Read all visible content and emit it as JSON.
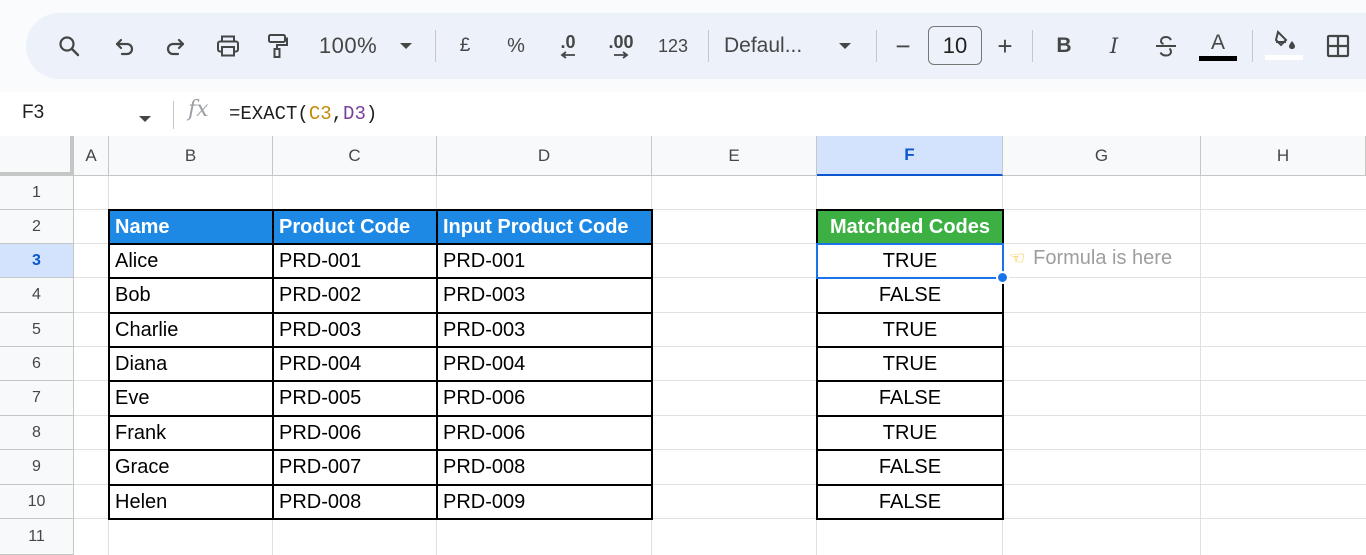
{
  "toolbar": {
    "zoom": "100%",
    "currency_symbol": "£",
    "percent_symbol": "%",
    "decrease_decimal": ".0",
    "increase_decimal": ".00",
    "number_format": "123",
    "font_family": "Defaul...",
    "font_size": "10",
    "minus": "−",
    "plus": "+",
    "bold": "B",
    "italic": "I",
    "text_color_letter": "A",
    "icons": [
      "search-icon",
      "undo-icon",
      "redo-icon",
      "print-icon",
      "paint-format-icon",
      "chevron-down-icon",
      "strikethrough-icon",
      "fill-color-icon",
      "borders-icon"
    ]
  },
  "formula_bar": {
    "name_box": "F3",
    "fx": "fx",
    "formula_prefix": "=EXACT(",
    "ref1": "C3",
    "comma": ",",
    "ref2": "D3",
    "formula_suffix": ")"
  },
  "columns": [
    "A",
    "B",
    "C",
    "D",
    "E",
    "F",
    "G",
    "H"
  ],
  "active_column": "F",
  "rows": [
    "1",
    "2",
    "3",
    "4",
    "5",
    "6",
    "7",
    "8",
    "9",
    "10",
    "11"
  ],
  "active_row": "3",
  "table": {
    "headers": [
      "Name",
      "Product Code",
      "Input Product Code"
    ],
    "rows": [
      [
        "Alice",
        "PRD-001",
        "PRD-001"
      ],
      [
        "Bob",
        "PRD-002",
        "PRD-003"
      ],
      [
        "Charlie",
        "PRD-003",
        "PRD-003"
      ],
      [
        "Diana",
        "PRD-004",
        "PRD-004"
      ],
      [
        "Eve",
        "PRD-005",
        "PRD-006"
      ],
      [
        "Frank",
        "PRD-006",
        "PRD-006"
      ],
      [
        "Grace",
        "PRD-007",
        "PRD-008"
      ],
      [
        "Helen",
        "PRD-008",
        "PRD-009"
      ]
    ]
  },
  "result": {
    "header": "Matchded Codes",
    "values": [
      "TRUE",
      "FALSE",
      "TRUE",
      "TRUE",
      "FALSE",
      "TRUE",
      "FALSE",
      "FALSE"
    ]
  },
  "annotation": {
    "text": "Formula is here",
    "icon": "pointing-hand-icon"
  },
  "colors": {
    "header_blue": "#1e88e5",
    "header_green": "#3cb043",
    "selection": "#1a73e8",
    "active_header": "#d3e3fd"
  }
}
